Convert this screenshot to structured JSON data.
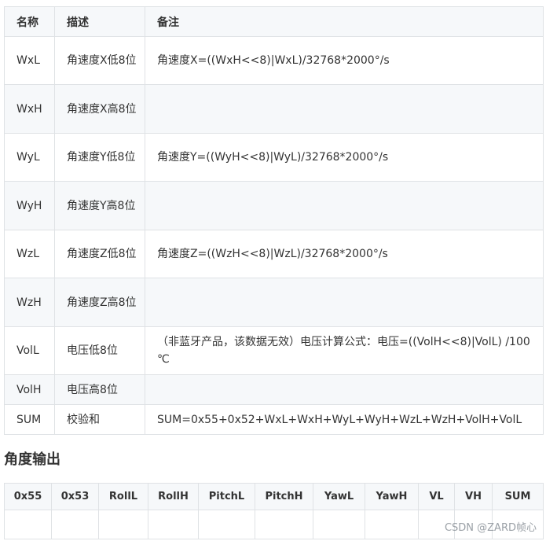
{
  "register_table": {
    "headers": [
      "名称",
      "描述",
      "备注"
    ],
    "rows": [
      {
        "name": "WxL",
        "desc": "角速度X低8位",
        "note": "角速度X=((WxH<<8)|WxL)/32768*2000°/s"
      },
      {
        "name": "WxH",
        "desc": "角速度X高8位",
        "note": ""
      },
      {
        "name": "WyL",
        "desc": "角速度Y低8位",
        "note": "角速度Y=((WyH<<8)|WyL)/32768*2000°/s"
      },
      {
        "name": "WyH",
        "desc": "角速度Y高8位",
        "note": ""
      },
      {
        "name": "WzL",
        "desc": "角速度Z低8位",
        "note": "角速度Z=((WzH<<8)|WzL)/32768*2000°/s"
      },
      {
        "name": "WzH",
        "desc": "角速度Z高8位",
        "note": ""
      },
      {
        "name": "VolL",
        "desc": "电压低8位",
        "note": "（非蓝牙产品，该数据无效）电压计算公式：电压=((VolH<<8)|VolL) /100 ℃"
      },
      {
        "name": "VolH",
        "desc": "电压高8位",
        "note": ""
      },
      {
        "name": "SUM",
        "desc": "校验和",
        "note": "SUM=0x55+0x52+WxL+WxH+WyL+WyH+WzL+WzH+VolH+VolL"
      }
    ]
  },
  "section_title": "角度输出",
  "angle_table": {
    "headers": [
      "0x55",
      "0x53",
      "RollL",
      "RollH",
      "PitchL",
      "PitchH",
      "YawL",
      "YawH",
      "VL",
      "VH",
      "SUM"
    ]
  },
  "watermark": "CSDN @ZARD帧心"
}
